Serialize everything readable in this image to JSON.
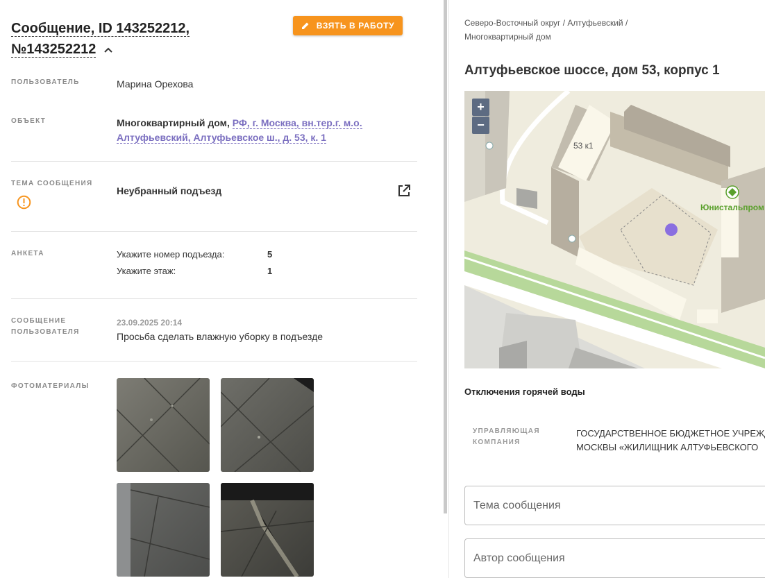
{
  "header": {
    "title_line1": "Сообщение, ID 143252212,",
    "title_line2": "№143252212",
    "take_button": "ВЗЯТЬ В РАБОТУ"
  },
  "fields": {
    "user_label": "ПОЛЬЗОВАТЕЛЬ",
    "user_value": "Марина Орехова",
    "object_label": "ОБЪЕКТ",
    "object_type": "Многоквартирный дом,",
    "object_link_line1": "РФ, г. Москва, вн.тер.г. м.о.",
    "object_link_line2": "Алтуфьевский, Алтуфьевское ш., д. 53, к. 1",
    "topic_label": "ТЕМА СООБЩЕНИЯ",
    "topic_value": "Неубранный подъезд",
    "survey_label": "АНКЕТА",
    "survey": [
      {
        "q": "Укажите номер подъезда:",
        "a": "5"
      },
      {
        "q": "Укажите этаж:",
        "a": "1"
      }
    ],
    "message_label_line1": "СООБЩЕНИЕ",
    "message_label_line2": "ПОЛЬЗОВАТЕЛЯ",
    "message_date": "23.09.2025 20:14",
    "message_text": "Просьба сделать влажную уборку в подъезде",
    "photos_label": "ФОТОМАТЕРИАЛЫ"
  },
  "right": {
    "breadcrumb_line1": "Северо-Восточный округ / Алтуфьевский /",
    "breadcrumb_line2": "Многоквартирный дом",
    "address": "Алтуфьевское шоссе, дом 53, корпус 1",
    "map": {
      "zoom_in": "+",
      "zoom_out": "−",
      "building_label": "53 к1",
      "poi_label": "Юнистальпром"
    },
    "hot_water": "Отключения горячей воды",
    "uk_label_line1": "УПРАВЛЯЮЩАЯ",
    "uk_label_line2": "КОМПАНИЯ",
    "uk_value_line1": "ГОСУДАРСТВЕННОЕ БЮДЖЕТНОЕ УЧРЕЖДЕНИЕ",
    "uk_value_line2": "МОСКВЫ «ЖИЛИЩНИК АЛТУФЬЕВСКОГО",
    "topic_placeholder": "Тема сообщения",
    "author_placeholder": "Автор сообщения"
  },
  "icons": {
    "pencil": "pencil-icon",
    "chevron": "chevron-up-icon",
    "warning": "warning-circle-icon",
    "external": "open-external-icon"
  },
  "colors": {
    "accent_orange": "#f7941d",
    "link_purple": "#7b6fc0",
    "poi_green": "#5aa02c",
    "map_pin": "#8a6fe0"
  }
}
